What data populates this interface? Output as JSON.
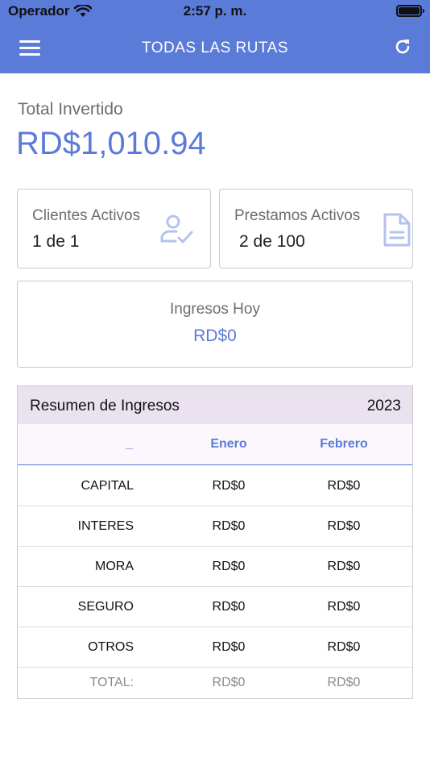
{
  "status_bar": {
    "carrier": "Operador",
    "time": "2:57 p. m."
  },
  "header": {
    "title": "TODAS LAS RUTAS",
    "menu_icon": "hamburger-menu-icon",
    "refresh_icon": "refresh-icon"
  },
  "summary_total": {
    "label": "Total Invertido",
    "value": "RD$1,010.94"
  },
  "cards": {
    "clientes": {
      "label": "Clientes Activos",
      "value": "1 de 1",
      "icon": "user-check-icon"
    },
    "prestamos": {
      "label": "Prestamos Activos",
      "value": "2 de 100",
      "icon": "document-icon"
    },
    "ingresos": {
      "label": "Ingresos Hoy",
      "value": "RD$0"
    }
  },
  "resumen": {
    "title": "Resumen de Ingresos",
    "year": "2023",
    "columns": [
      "_",
      "Enero",
      "Febrero"
    ],
    "rows": [
      {
        "label": "CAPITAL",
        "enero": "RD$0",
        "febrero": "RD$0"
      },
      {
        "label": "INTERES",
        "enero": "RD$0",
        "febrero": "RD$0"
      },
      {
        "label": "MORA",
        "enero": "RD$0",
        "febrero": "RD$0"
      },
      {
        "label": "SEGURO",
        "enero": "RD$0",
        "febrero": "RD$0"
      },
      {
        "label": "OTROS",
        "enero": "RD$0",
        "febrero": "RD$0"
      },
      {
        "label": "TOTAL:",
        "enero": "RD$0",
        "febrero": "RD$0"
      }
    ]
  },
  "colors": {
    "accent": "#5b7bd9",
    "header_bg": "#5b7bd9",
    "table_head_bg": "#ebe2ef",
    "icon_tint": "#b4c3ee"
  }
}
